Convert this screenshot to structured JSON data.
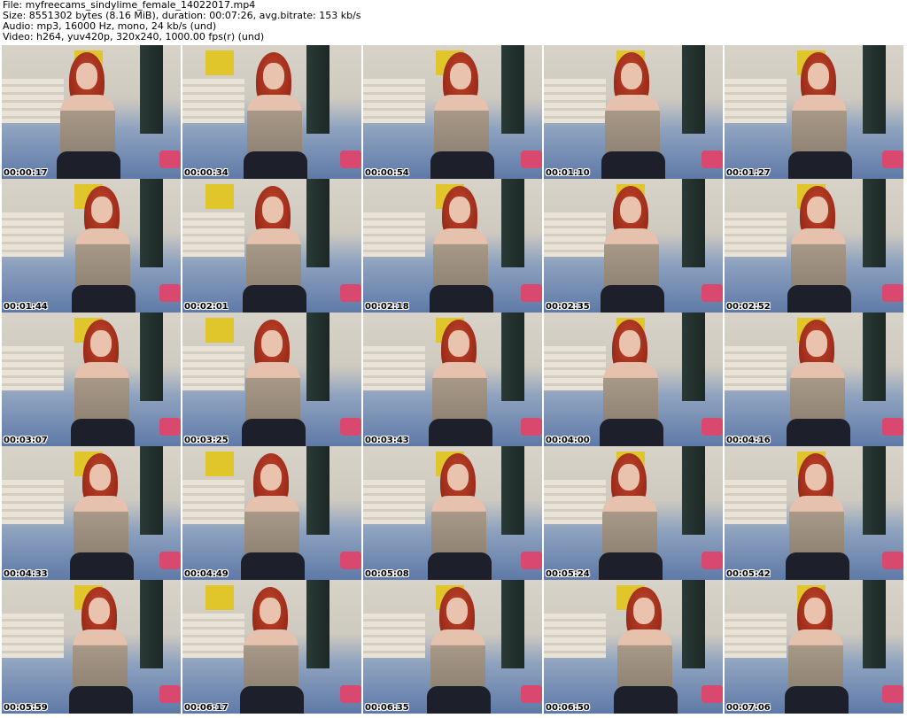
{
  "header": {
    "file": "File: myfreecams_sindylime_female_14022017.mp4",
    "size": "Size: 8551302 bytes (8.16 MiB), duration: 00:07:26, avg.bitrate: 153 kb/s",
    "audio": "Audio: mp3, 16000 Hz, mono, 24 kb/s (und)",
    "video": "Video: h264, yuv420p, 320x240, 1000.00 fps(r) (und)"
  },
  "thumbnails": [
    {
      "time": "00:00:17"
    },
    {
      "time": "00:00:34"
    },
    {
      "time": "00:00:54"
    },
    {
      "time": "00:01:10"
    },
    {
      "time": "00:01:27"
    },
    {
      "time": "00:01:44"
    },
    {
      "time": "00:02:01"
    },
    {
      "time": "00:02:18"
    },
    {
      "time": "00:02:35"
    },
    {
      "time": "00:02:52"
    },
    {
      "time": "00:03:07"
    },
    {
      "time": "00:03:25"
    },
    {
      "time": "00:03:43"
    },
    {
      "time": "00:04:00"
    },
    {
      "time": "00:04:16"
    },
    {
      "time": "00:04:33"
    },
    {
      "time": "00:04:49"
    },
    {
      "time": "00:05:08"
    },
    {
      "time": "00:05:24"
    },
    {
      "time": "00:05:42"
    },
    {
      "time": "00:05:59"
    },
    {
      "time": "00:06:17"
    },
    {
      "time": "00:06:35"
    },
    {
      "time": "00:06:50"
    },
    {
      "time": "00:07:06"
    }
  ]
}
